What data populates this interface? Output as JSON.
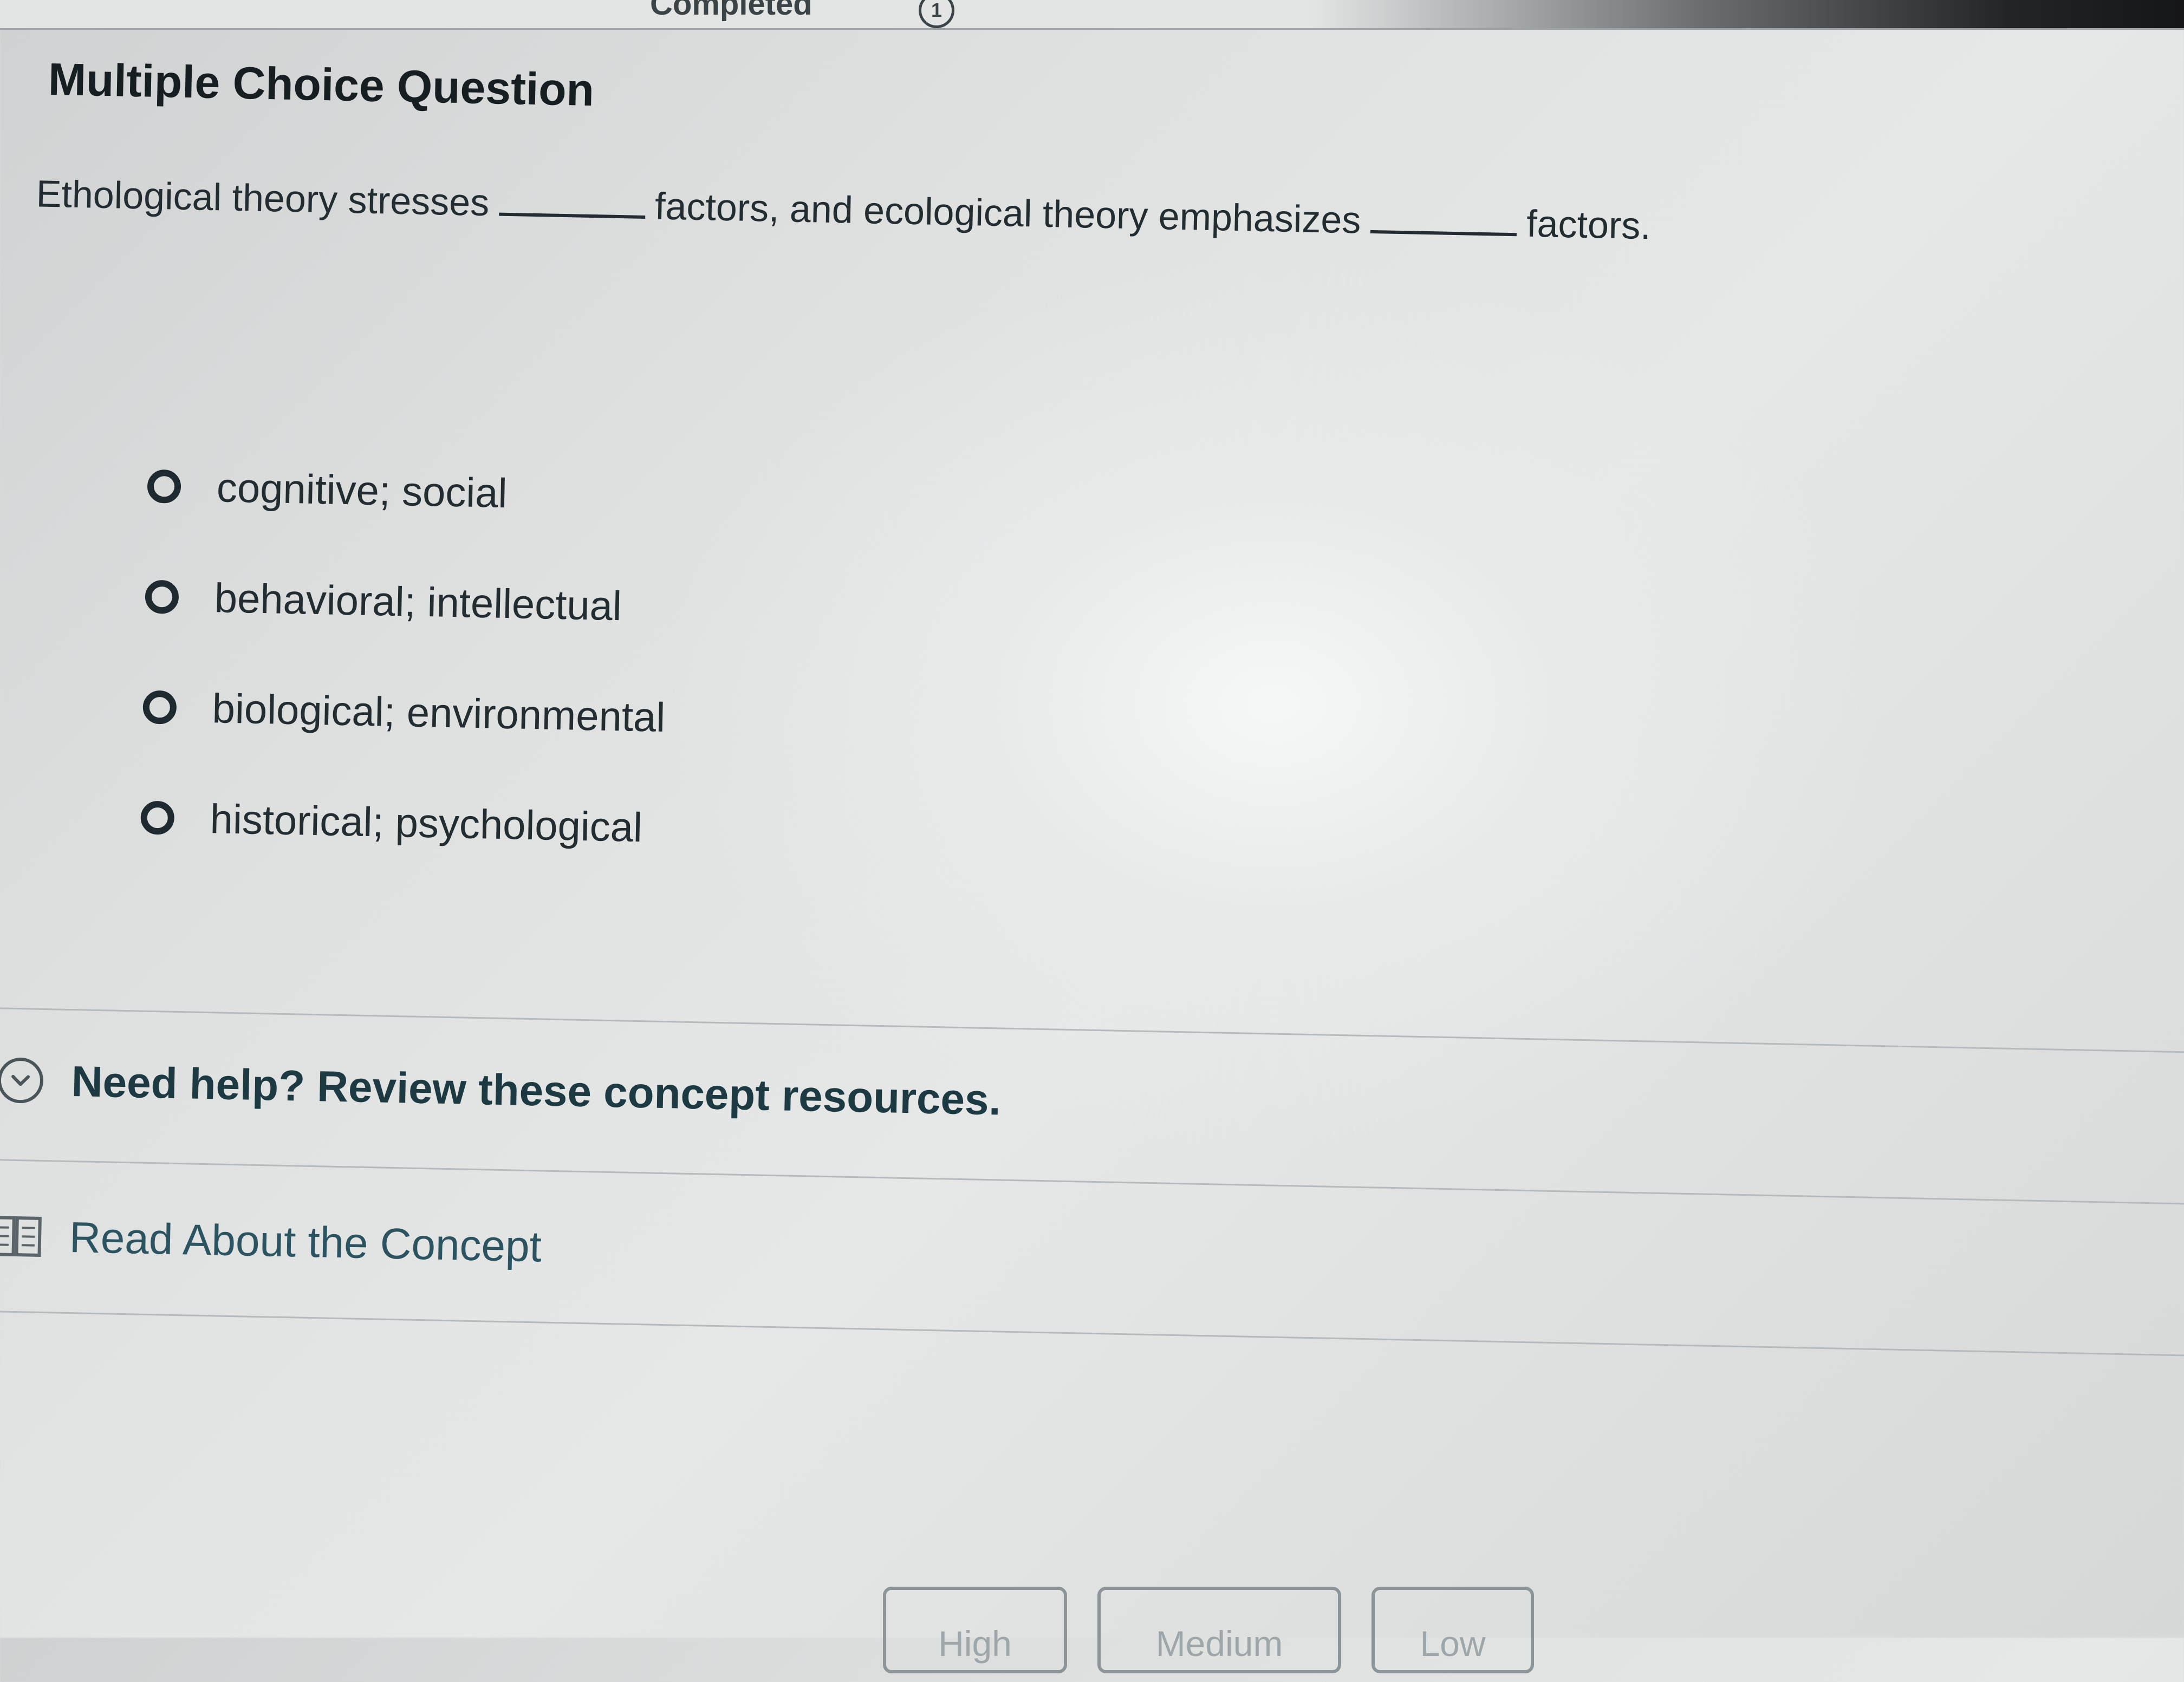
{
  "header": {
    "status_text": "Completed",
    "info_icon_text": "1"
  },
  "question": {
    "type_title": "Multiple Choice Question",
    "prompt_part1": "Ethological theory stresses",
    "prompt_part2": "factors, and ecological theory emphasizes",
    "prompt_part3": "factors.",
    "options": [
      {
        "label": "cognitive; social"
      },
      {
        "label": "behavioral; intellectual"
      },
      {
        "label": "biological; environmental"
      },
      {
        "label": "historical; psychological"
      }
    ]
  },
  "help": {
    "toggle_label": "Need help? Review these concept resources.",
    "toggle_icon": "chevron-down-circle-icon",
    "read_label": "Read About the Concept",
    "read_icon": "book-icon"
  },
  "confidence": {
    "high_label": "High",
    "medium_label": "Medium",
    "low_label": "Low"
  }
}
